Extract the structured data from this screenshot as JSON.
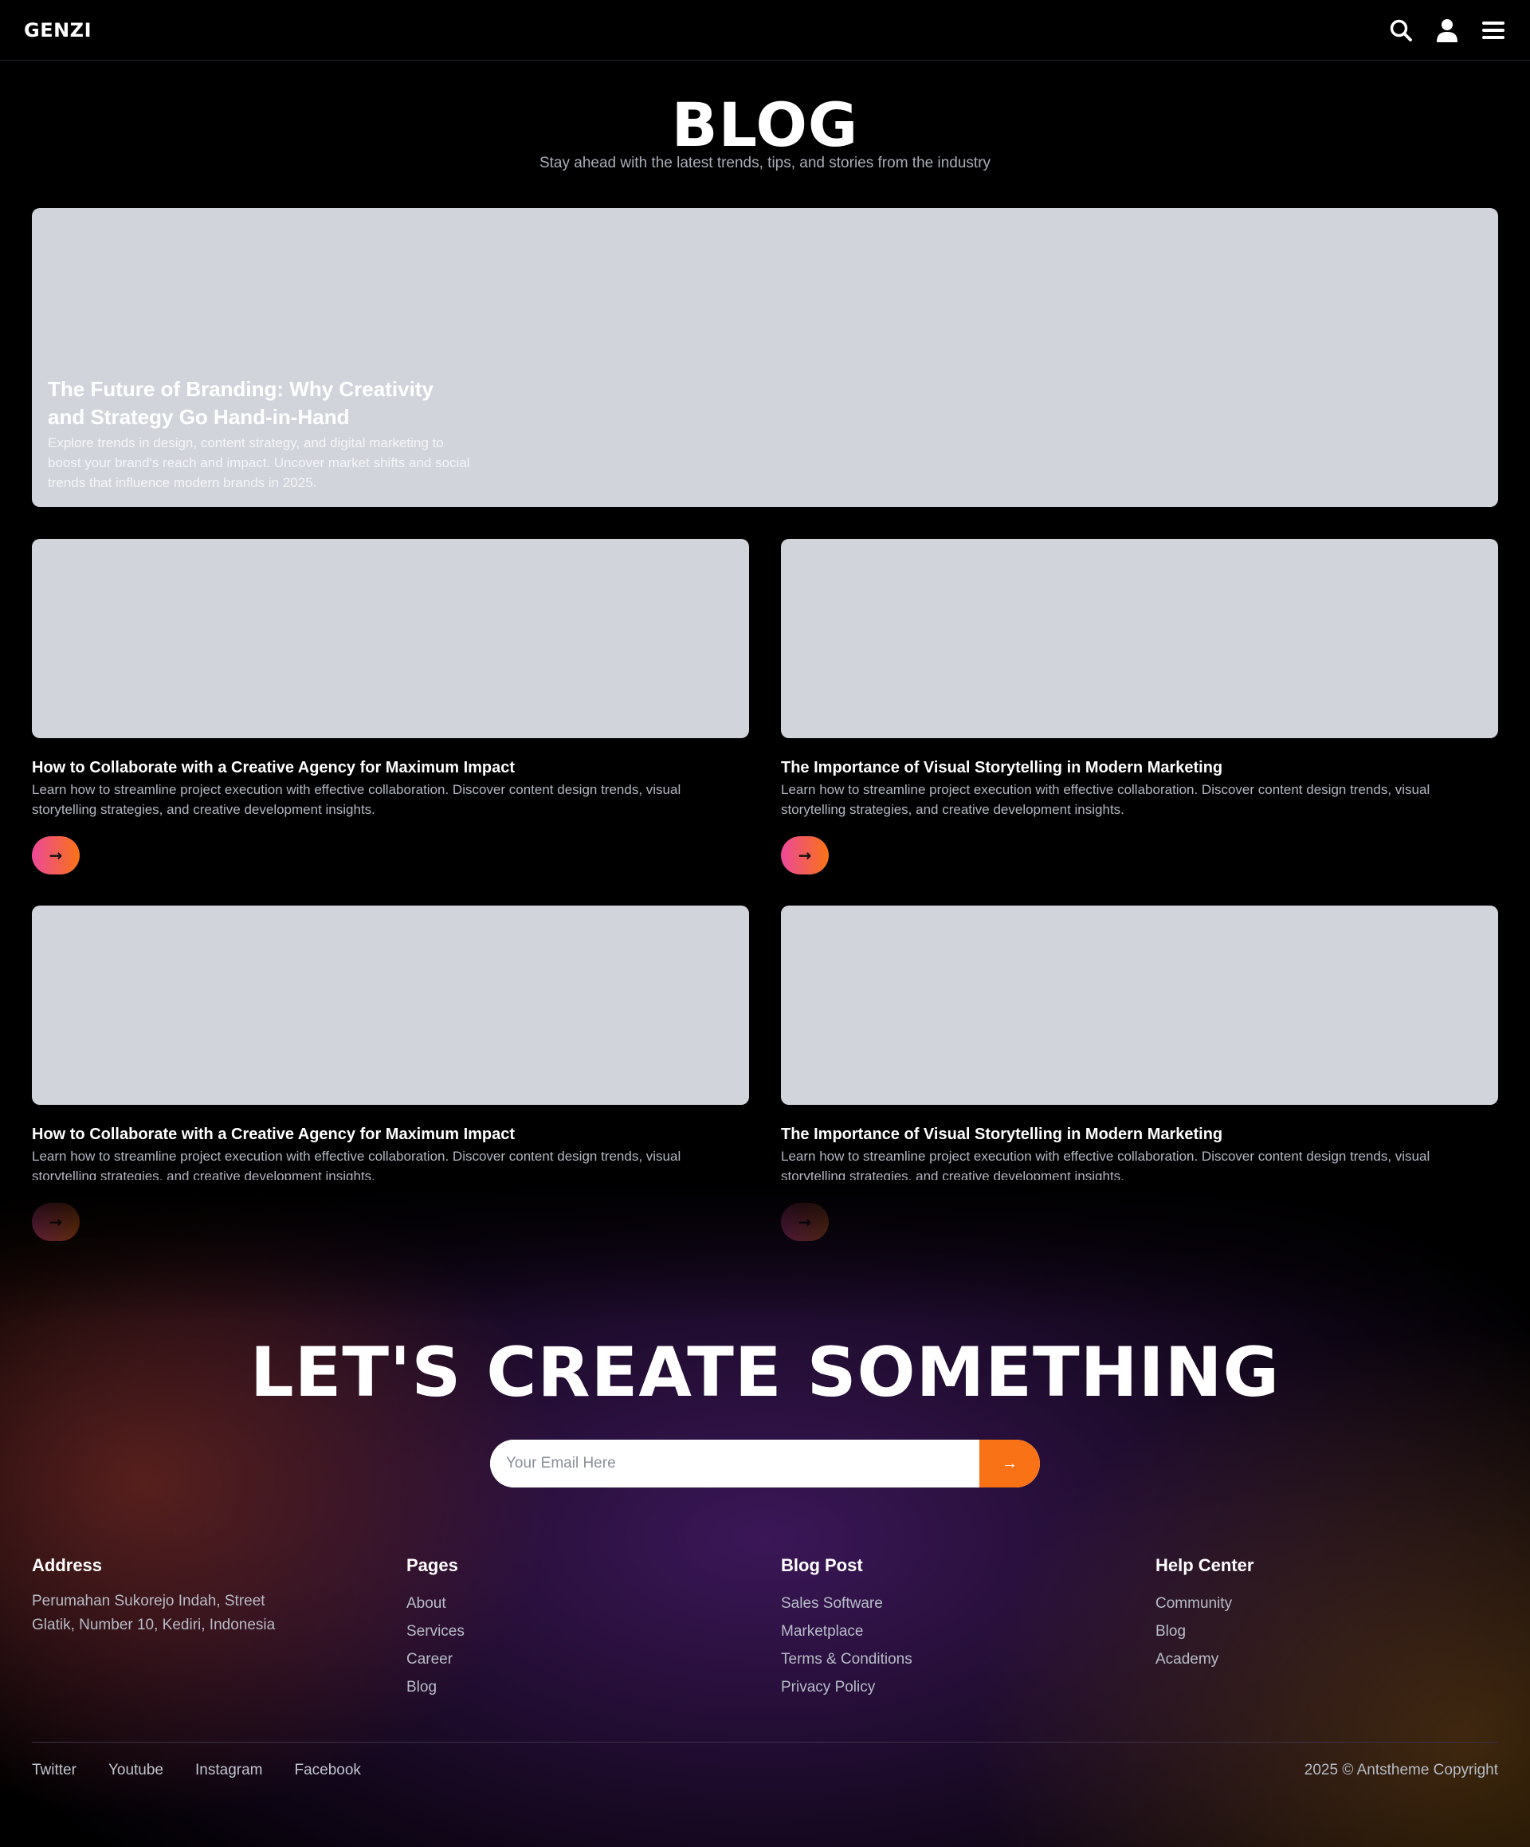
{
  "nav": {
    "logo": "GENZI",
    "icons": [
      "search-icon",
      "user-icon",
      "menu-icon"
    ]
  },
  "header": {
    "title": "BLOG",
    "subtitle": "Stay ahead with the latest trends, tips, and stories from the industry"
  },
  "featured": {
    "title": "The Future of Branding: Why Creativity and Strategy Go Hand-in-Hand",
    "description": "Explore trends in design, content strategy, and digital marketing to boost your brand's reach and impact. Uncover market shifts and social trends that influence modern brands in 2025."
  },
  "posts": [
    {
      "title": "How to Collaborate with a Creative Agency for Maximum Impact",
      "description": "Learn how to streamline project execution with effective collaboration. Discover content design trends, visual storytelling strategies, and creative development insights.",
      "button": "→"
    },
    {
      "title": "The Importance of Visual Storytelling in Modern Marketing",
      "description": "Learn how to streamline project execution with effective collaboration. Discover content design trends, visual storytelling strategies, and creative development insights.",
      "button": "→"
    },
    {
      "title": "How to Collaborate with a Creative Agency for Maximum Impact",
      "description": "Learn how to streamline project execution with effective collaboration. Discover content design trends, visual storytelling strategies, and creative development insights.",
      "button": "→"
    },
    {
      "title": "The Importance of Visual Storytelling in Modern Marketing",
      "description": "Learn how to streamline project execution with effective collaboration. Discover content design trends, visual storytelling strategies, and creative development insights.",
      "button": "→"
    }
  ],
  "cta": {
    "title": "LET'S CREATE SOMETHING",
    "email_placeholder": "Your Email Here",
    "submit_label": "→"
  },
  "footer": {
    "address": {
      "heading": "Address",
      "text": "Perumahan Sukorejo Indah, Street Glatik, Number 10, Kediri, Indonesia"
    },
    "pages": {
      "heading": "Pages",
      "items": [
        "About",
        "Services",
        "Career",
        "Blog"
      ]
    },
    "blog_post": {
      "heading": "Blog Post",
      "items": [
        "Sales Software",
        "Marketplace",
        "Terms & Conditions",
        "Privacy Policy"
      ]
    },
    "help_center": {
      "heading": "Help Center",
      "items": [
        "Community",
        "Blog",
        "Academy"
      ]
    },
    "socials": [
      "Twitter",
      "Youtube",
      "Instagram",
      "Facebook"
    ],
    "copyright": "2025 © Antstheme Copyright"
  },
  "colors": {
    "background": "#000000",
    "placeholder_image": "#d1d5db",
    "accent_pink": "#ec4899",
    "accent_orange": "#f97316"
  }
}
